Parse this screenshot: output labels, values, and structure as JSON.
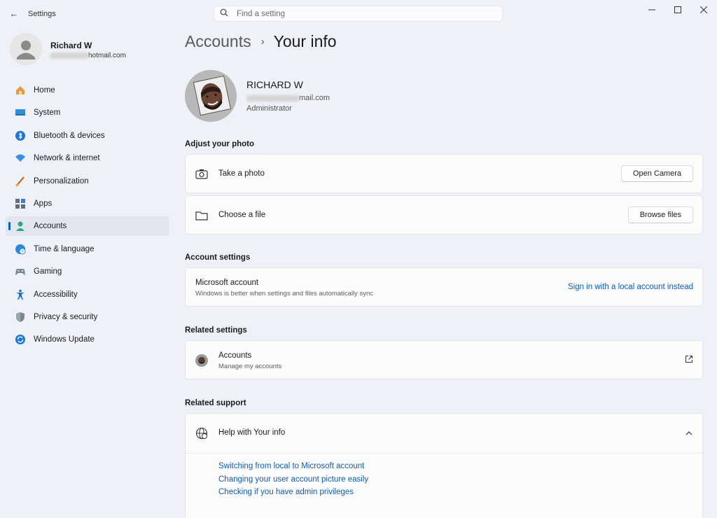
{
  "window": {
    "app_title": "Settings",
    "back_glyph": "←",
    "minimize_glyph": "—",
    "maximize_glyph": "☐",
    "close_glyph": "✕"
  },
  "search": {
    "placeholder": "Find a setting"
  },
  "profile": {
    "name": "Richard W",
    "email_visible": "hotmail.com"
  },
  "sidebar": {
    "accent": "#0067c0",
    "items": [
      {
        "label": "Home",
        "icon": "home-icon"
      },
      {
        "label": "System",
        "icon": "system-icon"
      },
      {
        "label": "Bluetooth & devices",
        "icon": "bluetooth-icon"
      },
      {
        "label": "Network & internet",
        "icon": "wifi-icon"
      },
      {
        "label": "Personalization",
        "icon": "brush-icon"
      },
      {
        "label": "Apps",
        "icon": "apps-icon"
      },
      {
        "label": "Accounts",
        "icon": "accounts-icon",
        "active": true
      },
      {
        "label": "Time & language",
        "icon": "globe-clock-icon"
      },
      {
        "label": "Gaming",
        "icon": "gamepad-icon"
      },
      {
        "label": "Accessibility",
        "icon": "accessibility-icon"
      },
      {
        "label": "Privacy & security",
        "icon": "shield-icon"
      },
      {
        "label": "Windows Update",
        "icon": "update-icon"
      }
    ]
  },
  "breadcrumb": {
    "parent": "Accounts",
    "separator": "›",
    "current": "Your info"
  },
  "hero": {
    "name": "RICHARD W",
    "email_visible": "mail.com",
    "role": "Administrator"
  },
  "adjust_photo": {
    "title": "Adjust your photo",
    "take_photo_label": "Take a photo",
    "open_camera_button": "Open Camera",
    "choose_file_label": "Choose a file",
    "browse_files_button": "Browse files"
  },
  "account_settings": {
    "title": "Account settings",
    "microsoft_account_label": "Microsoft account",
    "microsoft_account_desc": "Windows is better when settings and files automatically sync",
    "sign_in_local_link": "Sign in with a local account instead"
  },
  "related_settings": {
    "title": "Related settings",
    "accounts_label": "Accounts",
    "accounts_desc": "Manage my accounts"
  },
  "related_support": {
    "title": "Related support",
    "help_label": "Help with Your info",
    "links": [
      "Switching from local to Microsoft account",
      "Changing your user account picture easily",
      "Checking if you have admin privileges"
    ]
  }
}
